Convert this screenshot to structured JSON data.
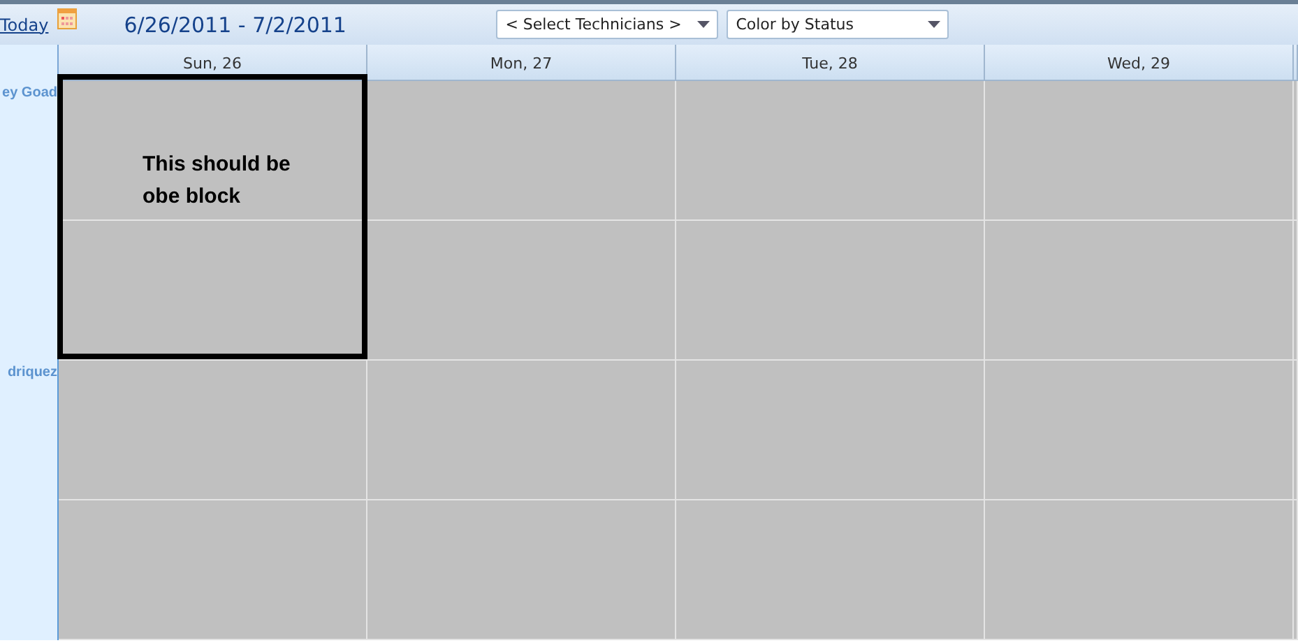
{
  "toolbar": {
    "today_link": "Today",
    "date_range": "6/26/2011 - 7/2/2011",
    "technician_select": "<  Select Technicians  >",
    "color_select": "Color by Status"
  },
  "days": [
    "Sun, 26",
    "Mon, 27",
    "Tue, 28",
    "Wed, 29"
  ],
  "resources": [
    {
      "name": "ey Goad"
    },
    {
      "name": "driquez"
    }
  ],
  "annotation": {
    "text": "This should be obe block"
  }
}
